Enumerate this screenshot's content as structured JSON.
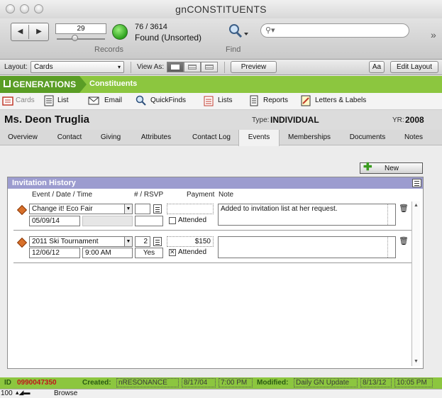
{
  "window": {
    "title": "gnCONSTITUENTS"
  },
  "toolbar": {
    "record_number": "29",
    "found_count": "76 / 3614",
    "found_status": "Found (Unsorted)",
    "records_label": "Records",
    "find_label": "Find",
    "search_placeholder": ""
  },
  "layoutbar": {
    "layout_label": "Layout:",
    "layout_value": "Cards",
    "view_as_label": "View As:",
    "preview_label": "Preview",
    "aa_label": "Aa",
    "edit_layout_label": "Edit Layout"
  },
  "breadcrumb": {
    "app": "GENERATIONS",
    "section": "Constituents"
  },
  "modules": [
    {
      "label": "Cards"
    },
    {
      "label": "List"
    },
    {
      "label": "Email"
    },
    {
      "label": "QuickFinds"
    },
    {
      "label": "Lists"
    },
    {
      "label": "Reports"
    },
    {
      "label": "Letters & Labels"
    }
  ],
  "constituent": {
    "name": "Ms. Deon Truglia",
    "type_label": "Type:",
    "type_value": "INDIVIDUAL",
    "yr_label": "YR:",
    "yr_value": "2008"
  },
  "tabs": [
    {
      "label": "Overview"
    },
    {
      "label": "Contact"
    },
    {
      "label": "Giving"
    },
    {
      "label": "Attributes"
    },
    {
      "label": "Contact Log"
    },
    {
      "label": "Events"
    },
    {
      "label": "Memberships"
    },
    {
      "label": "Documents"
    },
    {
      "label": "Notes"
    }
  ],
  "events": {
    "new_label": "New",
    "panel_title": "Invitation History",
    "columns": {
      "event": "Event / Date / Time",
      "rsvp": "# / RSVP",
      "payment": "Payment",
      "note": "Note"
    },
    "rows": [
      {
        "event": "Change it! Eco Fair",
        "date": "05/09/14",
        "time": "",
        "count": "",
        "rsvp": "",
        "payment": "",
        "attended_label": "Attended",
        "attended": false,
        "note": "Added to invitation list at her request."
      },
      {
        "event": "2011 Ski Tournament",
        "date": "12/06/12",
        "time": "9:00 AM",
        "count": "2",
        "rsvp": "Yes",
        "payment": "$150",
        "attended_label": "Attended",
        "attended": true,
        "note": ""
      }
    ]
  },
  "status": {
    "id_label": "ID",
    "id_value": "0990047350",
    "created_label": "Created:",
    "created_by": "nRESONANCE",
    "created_date": "8/17/04",
    "created_time": "7:00 PM",
    "modified_label": "Modified:",
    "modified_by": "Daily GN Update",
    "modified_date": "8/13/12",
    "modified_time": "10:05 PM"
  },
  "bottombar": {
    "zoom": "100",
    "mode": "Browse"
  },
  "colors": {
    "brand_green": "#8cc63f",
    "brand_dark_green": "#5a9d25",
    "portal_header": "#9c9ccf",
    "id_red": "#c0151a"
  }
}
